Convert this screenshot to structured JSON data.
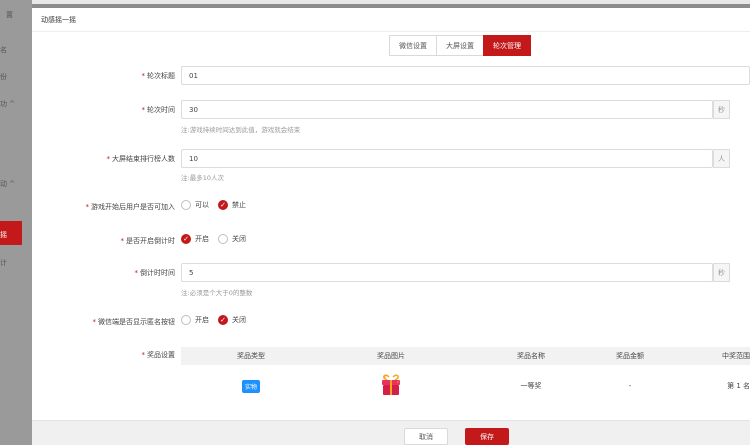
{
  "sidebar": {
    "items": [
      {
        "label": "置"
      },
      {
        "label": "名"
      },
      {
        "label": "份"
      },
      {
        "label": "功 ^"
      },
      {
        "label": "动 ^"
      },
      {
        "label": "摇"
      },
      {
        "label": "计"
      }
    ]
  },
  "modal": {
    "title": "动感摇一摇",
    "tabs": [
      {
        "label": "微信设置"
      },
      {
        "label": "大屏设置"
      },
      {
        "label": "轮次管理"
      }
    ],
    "active_tab": "轮次管理"
  },
  "form": {
    "round_title": {
      "label": "轮次标题",
      "value": "01"
    },
    "round_time": {
      "label": "轮次时间",
      "value": "30",
      "unit": "秒",
      "hint": "注:游戏持续时间达到此值，游戏就会结束"
    },
    "ranking_count": {
      "label": "大屏结束排行榜人数",
      "value": "10",
      "unit": "人",
      "hint": "注:最多10人次"
    },
    "join_after_start": {
      "label": "游戏开始后用户是否可加入",
      "options": [
        "可以",
        "禁止"
      ],
      "selected": "禁止"
    },
    "countdown_enabled": {
      "label": "是否开启倒计时",
      "options": [
        "开启",
        "关闭"
      ],
      "selected": "开启"
    },
    "countdown_time": {
      "label": "倒计时时间",
      "value": "5",
      "unit": "秒",
      "hint": "注:必须是个大于0的整数"
    },
    "show_anonymous": {
      "label": "微信端是否显示匿名按钮",
      "options": [
        "开启",
        "关闭"
      ],
      "selected": "关闭"
    },
    "prize_settings": {
      "label": "奖品设置",
      "columns": [
        "奖品类型",
        "奖品图片",
        "奖品名称",
        "奖品金额",
        "中奖范围"
      ],
      "rows": [
        {
          "type": "实物",
          "image": "gift-box-icon",
          "name": "一等奖",
          "amount": "-",
          "range": "第 1 名"
        }
      ]
    }
  },
  "footer": {
    "cancel_label": "取消",
    "save_label": "保存"
  },
  "colors": {
    "accent": "#c3191a",
    "badge": "#1e90ff"
  }
}
